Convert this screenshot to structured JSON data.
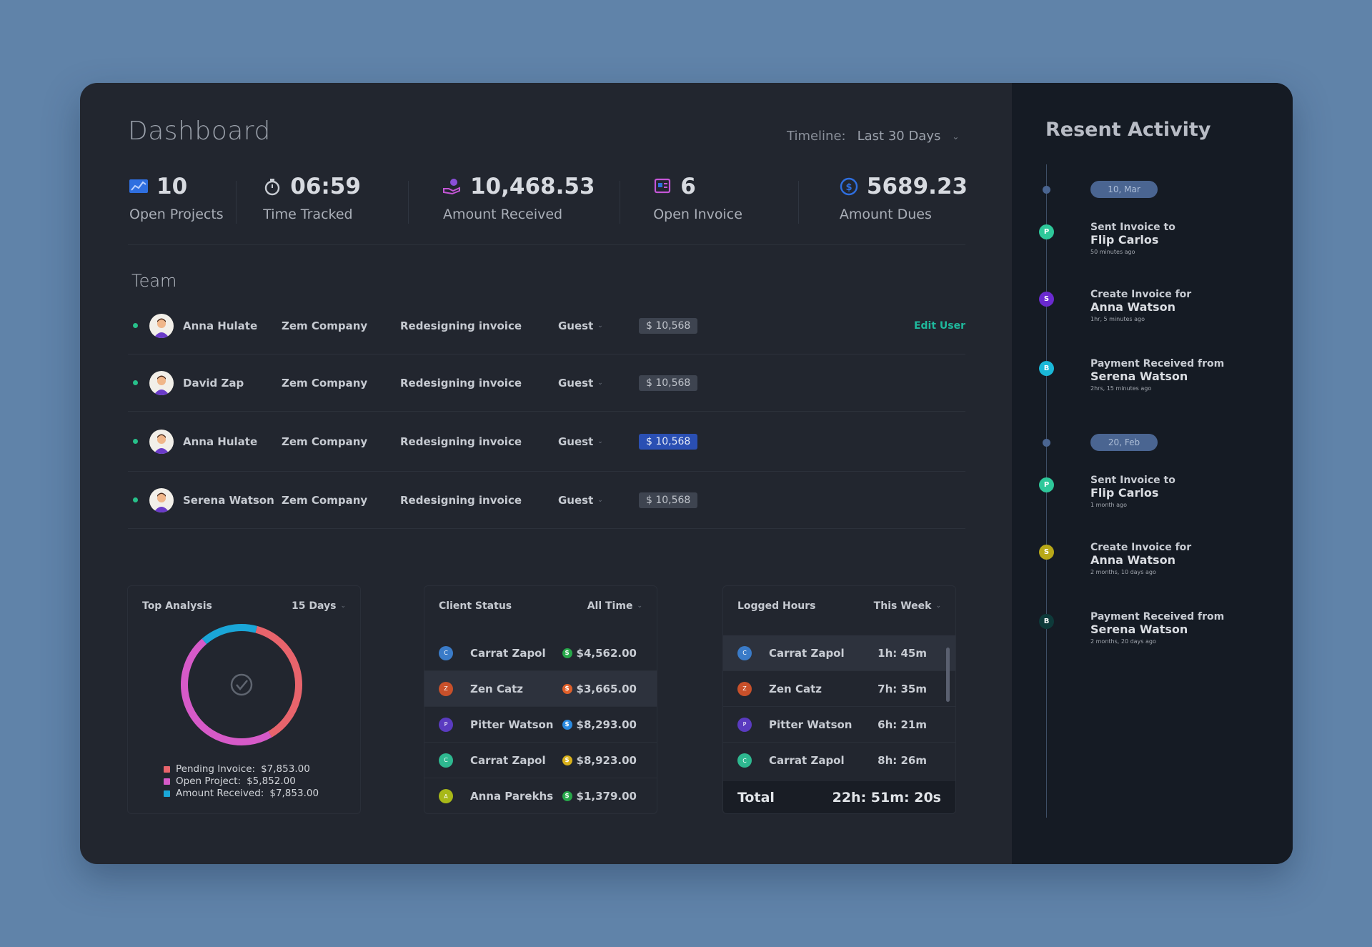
{
  "header": {
    "title": "Dashboard",
    "timeline_label": "Timeline:",
    "timeline_value": "Last 30 Days"
  },
  "stats": [
    {
      "value": "10",
      "label": "Open Projects",
      "icon": "chart-icon",
      "color": "#2f6fe0"
    },
    {
      "value": "06:59",
      "label": "Time Tracked",
      "icon": "stopwatch-icon",
      "color": "#c8ccd3"
    },
    {
      "value": "10,468.53",
      "label": "Amount Received",
      "icon": "hand-money-icon",
      "color": "#8a4fd8"
    },
    {
      "value": "6",
      "label": "Open Invoice",
      "icon": "invoice-icon",
      "color": "#c456d6"
    },
    {
      "value": "5689.23",
      "label": "Amount Dues",
      "icon": "dollar-circle-icon",
      "color": "#2f6fe0"
    }
  ],
  "team": {
    "title": "Team",
    "edit_label": "Edit User",
    "rows": [
      {
        "name": "Anna Hulate",
        "company": "Zem Company",
        "task": "Redesigning invoice",
        "role": "Guest",
        "amount": "$ 10,568"
      },
      {
        "name": "David Zap",
        "company": "Zem Company",
        "task": "Redesigning invoice",
        "role": "Guest",
        "amount": "$ 10,568"
      },
      {
        "name": "Anna Hulate",
        "company": "Zem Company",
        "task": "Redesigning invoice",
        "role": "Guest",
        "amount": "$ 10,568"
      },
      {
        "name": "Serena Watson",
        "company": "Zem Company",
        "task": "Redesigning invoice",
        "role": "Guest",
        "amount": "$ 10,568"
      }
    ]
  },
  "top_analysis": {
    "title": "Top Analysis",
    "range": "15 Days",
    "legend": [
      {
        "label": "Pending Invoice:",
        "value": "$7,853.00",
        "color": "#e8646c"
      },
      {
        "label": "Open Project:",
        "value": "$5,852.00",
        "color": "#d65ac8"
      },
      {
        "label": "Amount Received:",
        "value": "$7,853.00",
        "color": "#1aa6d8"
      }
    ],
    "segments": [
      {
        "name": "pending",
        "fraction": 0.375,
        "color": "#e8646c"
      },
      {
        "name": "open",
        "fraction": 0.47,
        "color": "#d65ac8"
      },
      {
        "name": "received",
        "fraction": 0.155,
        "color": "#1aa6d8"
      }
    ]
  },
  "client_status": {
    "title": "Client Status",
    "range": "All Time",
    "rows": [
      {
        "initial": "C",
        "name": "Carrat Zapol",
        "amount": "$4,562.00",
        "color": "#3a7bc8",
        "coin": "#27a84a"
      },
      {
        "initial": "Z",
        "name": "Zen Catz",
        "amount": "$3,665.00",
        "color": "#c8502a",
        "coin": "#e0602a"
      },
      {
        "initial": "P",
        "name": "Pitter Watson",
        "amount": "$8,293.00",
        "color": "#5a3bc0",
        "coin": "#2a8ae0"
      },
      {
        "initial": "C",
        "name": "Carrat Zapol",
        "amount": "$8,923.00",
        "color": "#2eb890",
        "coin": "#d8b01a"
      },
      {
        "initial": "A",
        "name": "Anna Parekhs",
        "amount": "$1,379.00",
        "color": "#a8b818",
        "coin": "#27a84a"
      }
    ]
  },
  "logged_hours": {
    "title": "Logged Hours",
    "range": "This Week",
    "rows": [
      {
        "initial": "C",
        "name": "Carrat Zapol",
        "hours": "1h: 45m",
        "color": "#3a7bc8"
      },
      {
        "initial": "Z",
        "name": "Zen Catz",
        "hours": "7h: 35m",
        "color": "#c8502a"
      },
      {
        "initial": "P",
        "name": "Pitter Watson",
        "hours": "6h: 21m",
        "color": "#5a3bc0"
      },
      {
        "initial": "C",
        "name": "Carrat Zapol",
        "hours": "8h: 26m",
        "color": "#2eb890"
      }
    ],
    "total_label": "Total",
    "total_value": "22h: 51m: 20s"
  },
  "activity": {
    "title": "Resent Activity",
    "dates": [
      "10, Mar",
      "20, Feb"
    ],
    "items": [
      {
        "marker": "P",
        "color": "#2ec89a",
        "line1": "Sent Invoice to",
        "line2": "Flip Carlos",
        "time": "50 minutes ago"
      },
      {
        "marker": "S",
        "color": "#6a2ad0",
        "line1": "Create Invoice for",
        "line2": "Anna Watson",
        "time": "1hr, 5 minutes ago"
      },
      {
        "marker": "B",
        "color": "#1ab8d8",
        "line1": "Payment Received from",
        "line2": "Serena Watson",
        "time": "2hrs, 15 minutes ago"
      },
      {
        "marker": "P",
        "color": "#2ec89a",
        "line1": "Sent Invoice to",
        "line2": "Flip Carlos",
        "time": "1 month ago"
      },
      {
        "marker": "S",
        "color": "#b8a818",
        "line1": "Create Invoice for",
        "line2": "Anna Watson",
        "time": "2 months, 10 days ago"
      },
      {
        "marker": "B",
        "color": "#0e3a3a",
        "line1": "Payment Received from",
        "line2": "Serena Watson",
        "time": "2 months, 20 days ago"
      }
    ]
  }
}
